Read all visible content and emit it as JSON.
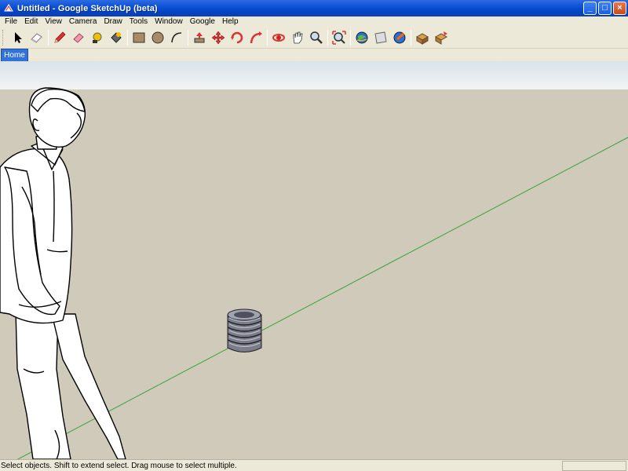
{
  "window": {
    "title": "Untitled - Google SketchUp (beta)",
    "controls": {
      "minimize": "_",
      "maximize": "□",
      "close": "×"
    }
  },
  "menubar": {
    "items": [
      "File",
      "Edit",
      "View",
      "Camera",
      "Draw",
      "Tools",
      "Window",
      "Google",
      "Help"
    ]
  },
  "toolbar": {
    "tools": [
      "select-icon",
      "eraser-icon",
      "pencil-icon",
      "paint-bucket-icon",
      "rectangle-tool-icon",
      "push-pull-icon",
      "rectangle-icon",
      "circle-icon",
      "arc-icon",
      "move-icon",
      "rotate-icon",
      "offset-icon",
      "follow-me-icon",
      "orbit-icon",
      "pan-icon",
      "zoom-icon",
      "zoom-extents-icon",
      "get-models-icon",
      "share-model-icon",
      "place-model-icon",
      "components-icon",
      "component-settings-icon"
    ]
  },
  "scenes": {
    "tabs": [
      "Home"
    ]
  },
  "statusbar": {
    "message": "Select objects. Shift to extend select. Drag mouse to select multiple."
  },
  "colors": {
    "sky": "#e6ecef",
    "ground": "#cfcab9",
    "axis_green": "#3aa53a",
    "spring": "#8a8c98",
    "title_blue": "#0a52d6"
  }
}
